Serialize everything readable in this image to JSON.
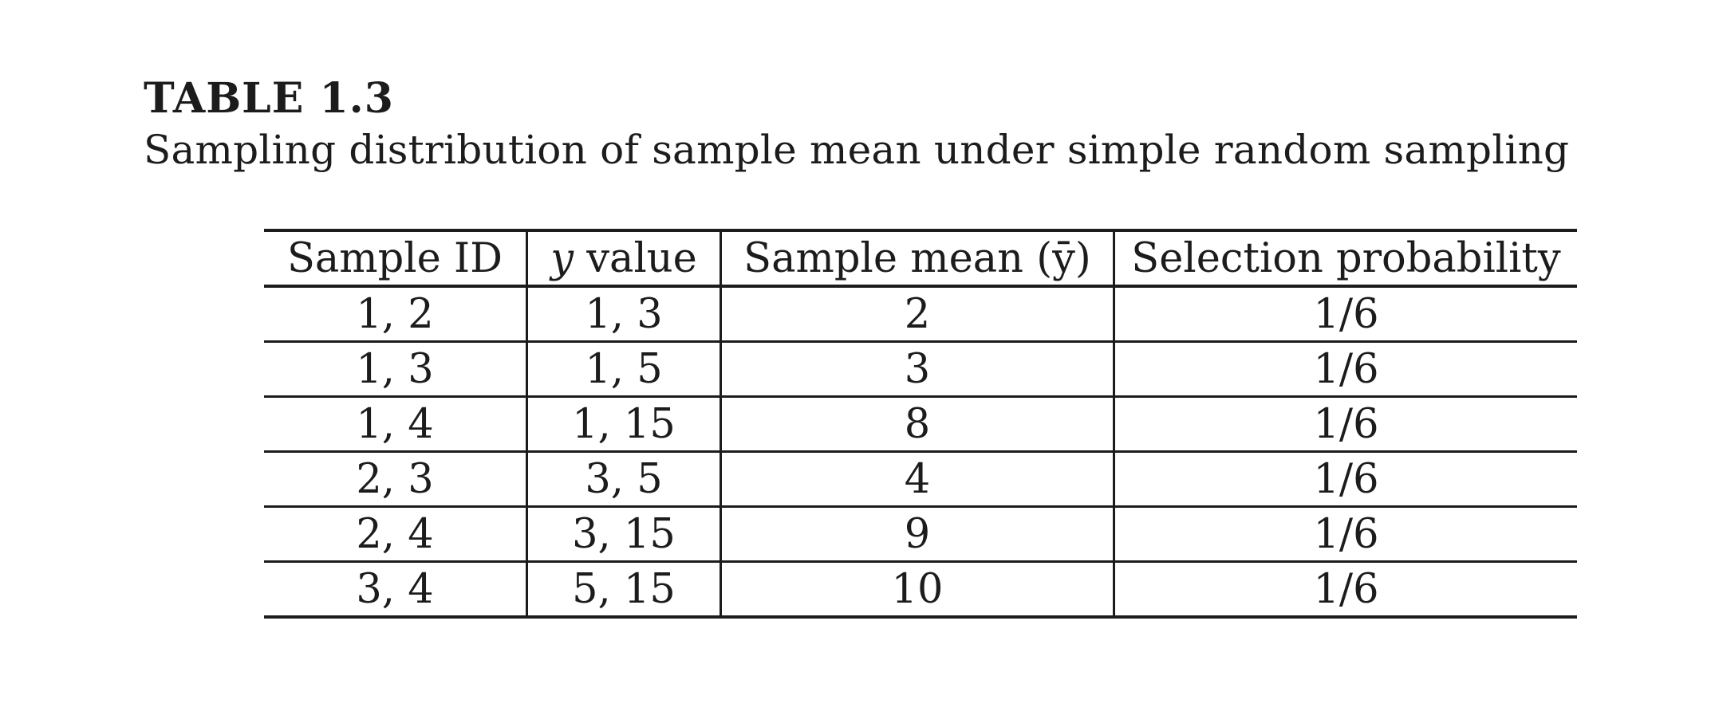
{
  "caption": {
    "label": "TABLE 1.3",
    "title": "Sampling distribution of sample mean under simple random sampling"
  },
  "table": {
    "headers": {
      "sample_id": "Sample ID",
      "y_var": "y",
      "y_value_rest": " value",
      "sample_mean": "Sample mean (ȳ)",
      "selection_probability": "Selection probability"
    },
    "rows": [
      {
        "sample_id": "1, 2",
        "y_value": "1, 3",
        "sample_mean": "2",
        "probability": "1/6"
      },
      {
        "sample_id": "1, 3",
        "y_value": "1, 5",
        "sample_mean": "3",
        "probability": "1/6"
      },
      {
        "sample_id": "1, 4",
        "y_value": "1, 15",
        "sample_mean": "8",
        "probability": "1/6"
      },
      {
        "sample_id": "2, 3",
        "y_value": "3, 5",
        "sample_mean": "4",
        "probability": "1/6"
      },
      {
        "sample_id": "2, 4",
        "y_value": "3, 15",
        "sample_mean": "9",
        "probability": "1/6"
      },
      {
        "sample_id": "3, 4",
        "y_value": "5, 15",
        "sample_mean": "10",
        "probability": "1/6"
      }
    ]
  }
}
